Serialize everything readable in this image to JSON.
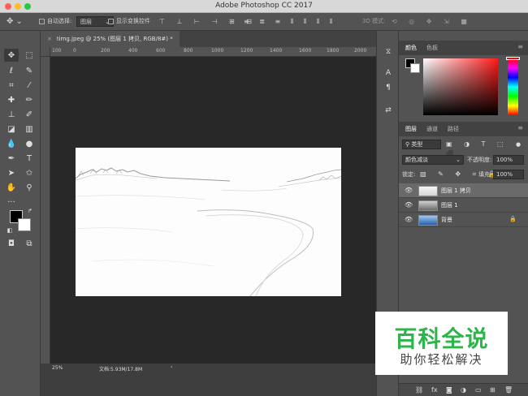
{
  "window": {
    "title": "Adobe Photoshop CC 2017"
  },
  "options_bar": {
    "auto_select_label": "自动选择:",
    "auto_select_value": "图层",
    "show_transform_label": "显示变换控件",
    "mode_3d_label": "3D 模式:"
  },
  "document": {
    "tab_label": "timg.jpeg @ 25% (图层 1 拷贝, RGB/8#) *",
    "close_glyph": "×",
    "zoom": "25%",
    "doc_info": "文档:5.93M/17.8M",
    "info_arrow": "›"
  },
  "ruler": {
    "labels": [
      "100",
      "0",
      "200",
      "400",
      "600",
      "800",
      "1000",
      "1200",
      "1400",
      "1600",
      "1800",
      "2000"
    ]
  },
  "color_panel": {
    "tabs": [
      "颜色",
      "色板"
    ],
    "menu_glyph": "≡"
  },
  "layers_panel": {
    "tabs": [
      "图层",
      "通道",
      "路径"
    ],
    "filter_label": "类型",
    "blend_mode": "颜色减淡",
    "opacity_label": "不透明度:",
    "opacity_value": "100%",
    "lock_label": "锁定:",
    "fill_label": "填充:",
    "fill_value": "100%",
    "layers": [
      {
        "name": "图层 1 拷贝",
        "selected": true
      },
      {
        "name": "图层 1",
        "selected": false
      },
      {
        "name": "背景",
        "selected": false,
        "locked": true
      }
    ]
  },
  "watermark": {
    "title": "百科全说",
    "subtitle": "助你轻松解决"
  },
  "colors": {
    "panel_bg": "#535353",
    "canvas_bg": "#282828",
    "selected_layer": "#6a6a6a",
    "watermark_green": "#2db44a"
  }
}
